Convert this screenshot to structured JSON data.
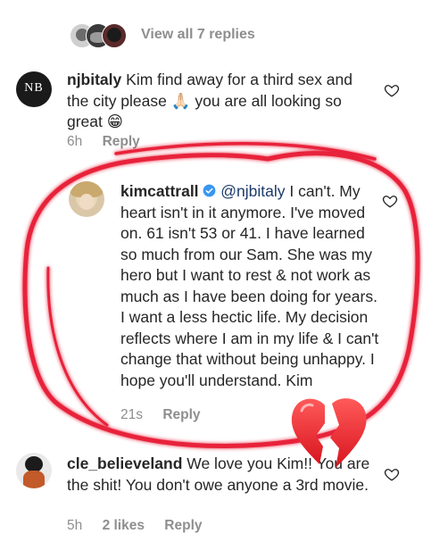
{
  "view_replies": {
    "label": "View all 7 replies"
  },
  "comments": [
    {
      "username": "njbitaly",
      "avatar_text": "NB",
      "text": "Kim find away for a third sex and the city please",
      "emoji_1": "🙏🏻",
      "text_after_emoji_1": "you are all looking so great",
      "emoji_2": "😁",
      "time": "6h",
      "reply_label": "Reply"
    },
    {
      "username": "kimcattrall",
      "mention": "@njbitaly",
      "text": "I can't. My heart isn't in it anymore. I've moved on. 61 isn't 53 or 41. I have learned so much from our Sam. She was my hero but I want to rest & not work as much as I have been doing for years. I want a less hectic life. My decision reflects where I am in my life & I can't change that without being unhappy. I hope you'll understand. Kim",
      "time": "21s",
      "reply_label": "Reply"
    },
    {
      "username": "cle_believeland",
      "text": "We love you Kim!! You are the shit! You don't owe anyone a 3rd movie.",
      "time": "5h",
      "likes": "2 likes",
      "reply_label": "Reply"
    }
  ],
  "colors": {
    "text": "#262626",
    "muted": "#8e8e8e",
    "verified": "#3897f0",
    "annotation_red": "#e8243a"
  },
  "icons": {
    "like": "heart-outline-icon",
    "verified": "verified-badge-icon",
    "broken_heart": "broken-heart-emoji"
  }
}
